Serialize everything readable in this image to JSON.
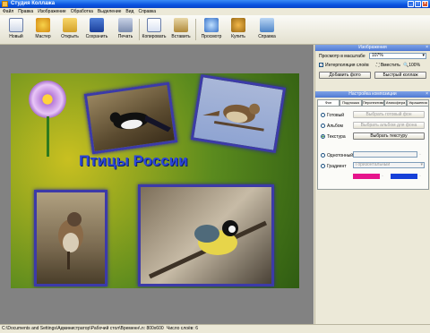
{
  "window": {
    "title": "Студия Коллажа"
  },
  "menu": [
    "Файл",
    "Правка",
    "Изображение",
    "Обработка",
    "Выделение",
    "Вид",
    "Справка"
  ],
  "toolbar": {
    "new": "Новый",
    "wizard": "Мастер",
    "open": "Открыть",
    "save": "Сохранить",
    "print": "Печать",
    "copy": "Копировать",
    "paste": "Вставить",
    "preview": "Просмотр",
    "buy": "Купить",
    "help": "Справка"
  },
  "collage": {
    "title": "Птицы России"
  },
  "images_panel": {
    "header": "Изображения",
    "scale_label": "Просмотр в масштабе",
    "scale_value": "107%",
    "interpolate_label": "Интерполяция слоёв",
    "fit_label": "Вместить",
    "zoom100_label": "100%",
    "add_photo": "Добавить фото",
    "quick_collage": "Быстрый коллаж"
  },
  "composition_panel": {
    "header": "Настройка композиции",
    "tabs": [
      "Фон",
      "Подложка",
      "Перспектива",
      "Атмосфера",
      "Украшения"
    ],
    "ready_label": "Готовый",
    "ready_button": "Выбрать готовый фон",
    "album_label": "Альбом",
    "album_button": "Выбрать альбом для фона",
    "texture_label": "Текстура",
    "texture_button": "Выбрать текстуру",
    "solid_label": "Однотонный",
    "gradient_label": "Градиент",
    "gradient_value": "Горизонтальный",
    "gradient_color1": "#e6158c",
    "gradient_color2": "#1640d8"
  },
  "status": {
    "path": "C:\\Documents and Settings\\Администратор\\Рабочий стол\\Временн\\.n: 800x600",
    "layers": "Число слоёв: 6"
  }
}
